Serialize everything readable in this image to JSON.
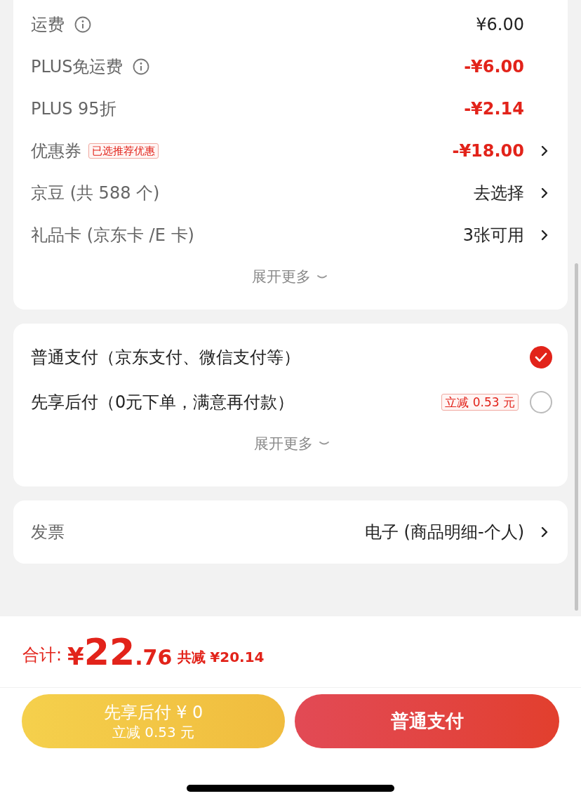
{
  "fees": {
    "rows": [
      {
        "label": "运费",
        "info": true,
        "value": "¥6.00",
        "discount": false,
        "arrow": false
      },
      {
        "label": "PLUS免运费",
        "info": true,
        "value": "-¥6.00",
        "discount": true,
        "arrow": false
      },
      {
        "label": "PLUS 95折",
        "info": false,
        "value": "-¥2.14",
        "discount": true,
        "arrow": false
      },
      {
        "label": "优惠券",
        "info": false,
        "badge": "已选推荐优惠",
        "value": "-¥18.00",
        "discount": true,
        "arrow": true
      },
      {
        "label": "京豆 (共 588 个)",
        "info": false,
        "value": "去选择",
        "discount": false,
        "arrow": true
      },
      {
        "label": "礼品卡 (京东卡 /E 卡)",
        "info": false,
        "value": "3张可用",
        "discount": false,
        "arrow": true
      }
    ],
    "expand": "展开更多"
  },
  "payment": {
    "options": [
      {
        "label": "普通支付（京东支付、微信支付等）",
        "selected": true
      },
      {
        "label": "先享后付（0元下单，满意再付款）",
        "badge": "立减 0.53 元",
        "selected": false
      }
    ],
    "expand": "展开更多"
  },
  "invoice": {
    "label": "发票",
    "value": "电子 (商品明细-个人)"
  },
  "total": {
    "label": "合计:",
    "currency": "¥",
    "integer": "22",
    "decimal": ".76",
    "saving_label": "共减",
    "saving": "¥20.14"
  },
  "buttons": [
    {
      "kind": "later",
      "title": "先享后付 ¥ 0",
      "subtitle": "立减 0.53 元"
    },
    {
      "kind": "pay",
      "title": "普通支付"
    }
  ]
}
